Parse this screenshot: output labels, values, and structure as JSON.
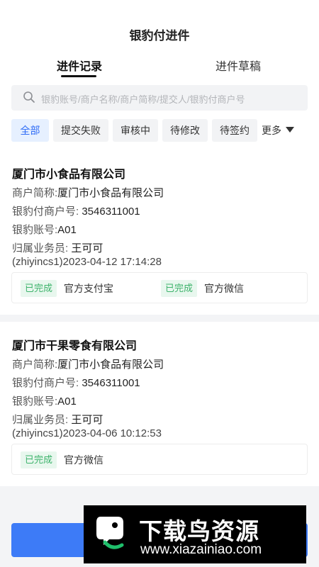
{
  "header": {
    "title": "银豹付进件"
  },
  "tabs": [
    {
      "label": "进件记录",
      "active": true
    },
    {
      "label": "进件草稿",
      "active": false
    }
  ],
  "search": {
    "placeholder": "银豹账号/商户名称/商户简称/提交人/银豹付商户号",
    "icon": "search-icon"
  },
  "filters": {
    "chips": [
      {
        "label": "全部",
        "active": true
      },
      {
        "label": "提交失败",
        "active": false
      },
      {
        "label": "审核中",
        "active": false
      },
      {
        "label": "待修改",
        "active": false
      },
      {
        "label": "待签约",
        "active": false
      }
    ],
    "more_label": "更多"
  },
  "records": [
    {
      "name": "厦门市小食品有限公司",
      "short_label": "商户简称:",
      "short_value": "厦门市小食品有限公司",
      "merchant_no_label": "银豹付商户号:",
      "merchant_no": "3546311001",
      "account_label": "银豹账号:",
      "account": "A01",
      "salesperson_label": "归属业务员:",
      "salesperson": "王可可",
      "submitter_time": "(zhiyincs1)2023-04-12 17:14:28",
      "statuses": [
        {
          "badge": "已完成",
          "channel": "官方支付宝"
        },
        {
          "badge": "已完成",
          "channel": "官方微信"
        }
      ]
    },
    {
      "name": "厦门市干果零食有限公司",
      "short_label": "商户简称:",
      "short_value": "厦门市小食品有限公司",
      "merchant_no_label": "银豹付商户号:",
      "merchant_no": "3546311001",
      "account_label": "银豹账号:",
      "account": "A01",
      "salesperson_label": "归属业务员:",
      "salesperson": "王可可",
      "submitter_time": "(zhiyincs1)2023-04-06 10:12:53",
      "statuses": [
        {
          "badge": "已完成",
          "channel": "官方微信"
        }
      ]
    }
  ],
  "watermark": {
    "title": "下载鸟资源",
    "url": "www.xiazainiao.com"
  },
  "colors": {
    "accent": "#2f6cf6",
    "success": "#3db36b",
    "primary_button": "#3d7bf7"
  }
}
